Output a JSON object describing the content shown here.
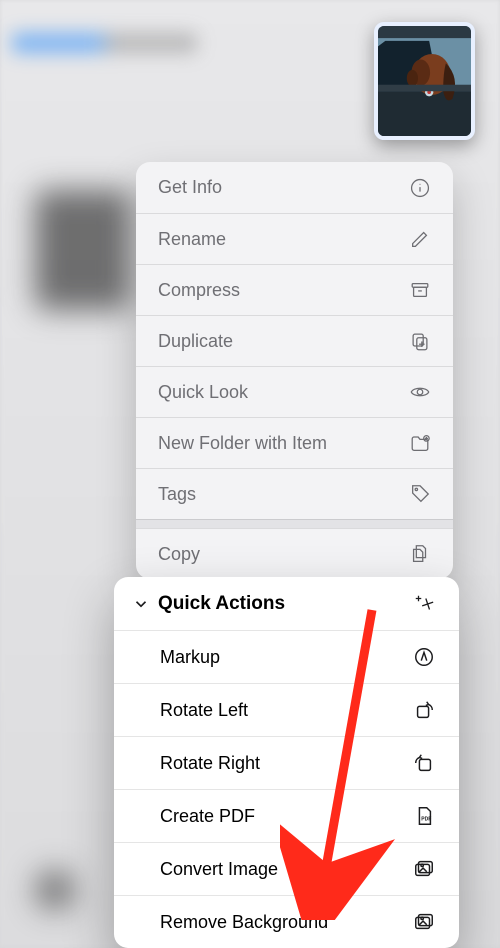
{
  "contextMenu": {
    "items": [
      {
        "label": "Get Info",
        "icon": "info"
      },
      {
        "label": "Rename",
        "icon": "pencil"
      },
      {
        "label": "Compress",
        "icon": "archivebox"
      },
      {
        "label": "Duplicate",
        "icon": "duplicate"
      },
      {
        "label": "Quick Look",
        "icon": "eye"
      },
      {
        "label": "New Folder with Item",
        "icon": "folderplus"
      },
      {
        "label": "Tags",
        "icon": "tag"
      }
    ],
    "copy": {
      "label": "Copy",
      "icon": "docs"
    }
  },
  "quickActions": {
    "title": "Quick Actions",
    "items": [
      {
        "label": "Markup",
        "icon": "markup"
      },
      {
        "label": "Rotate Left",
        "icon": "rotleft"
      },
      {
        "label": "Rotate Right",
        "icon": "rotright"
      },
      {
        "label": "Create PDF",
        "icon": "pdf"
      },
      {
        "label": "Convert Image",
        "icon": "images"
      },
      {
        "label": "Remove Background",
        "icon": "images"
      }
    ]
  }
}
